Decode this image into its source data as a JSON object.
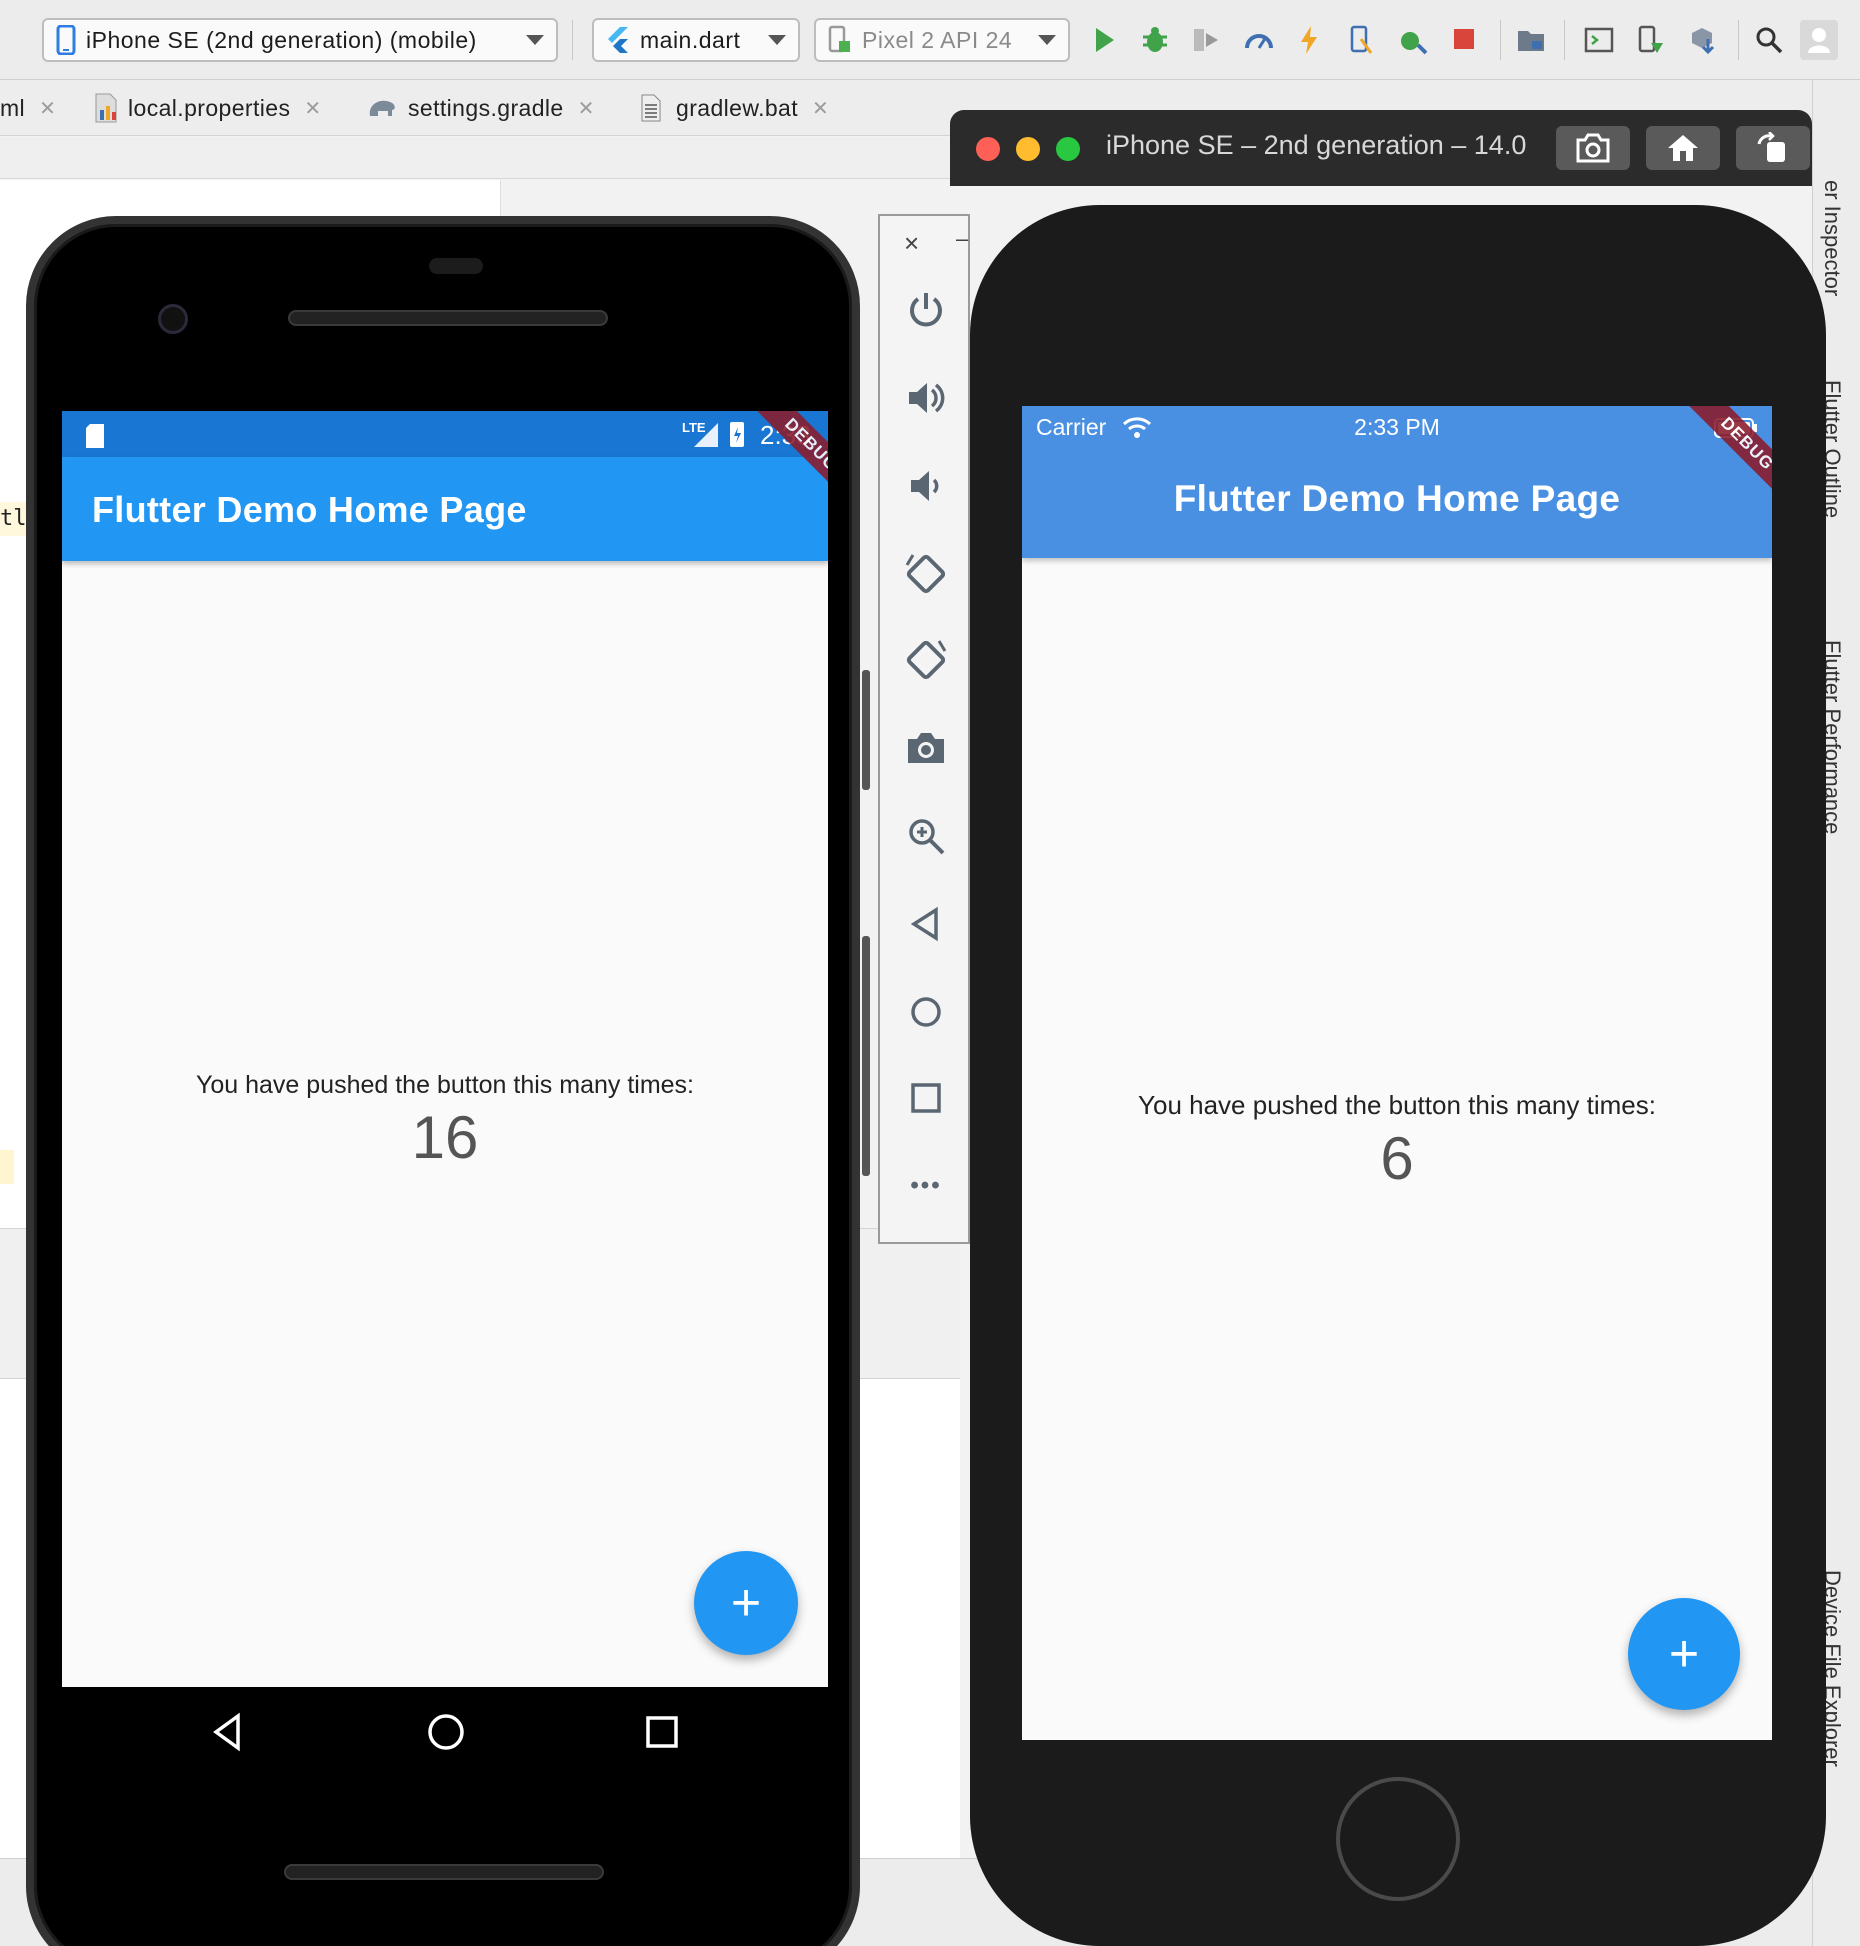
{
  "toolbar": {
    "device_select": "iPhone SE (2nd generation) (mobile)",
    "run_config": "main.dart",
    "emulator_select": "Pixel 2 API 24"
  },
  "tabs": [
    {
      "label": "ml"
    },
    {
      "label": "local.properties"
    },
    {
      "label": "settings.gradle"
    },
    {
      "label": "gradlew.bat"
    }
  ],
  "editor": {
    "fragment": "tl"
  },
  "android": {
    "status_time": "2:33",
    "status_network": "LTE",
    "app_title": "Flutter Demo Home Page",
    "debug_banner": "DEBUG",
    "message": "You have pushed the button this many times:",
    "counter": "16",
    "fab_label": "+"
  },
  "emulator_panel": {
    "close": "×",
    "minimize": "–",
    "more": "•••"
  },
  "ios_simulator": {
    "window_title": "iPhone SE – 2nd generation – 14.0",
    "carrier": "Carrier",
    "time": "2:33 PM",
    "app_title": "Flutter Demo Home Page",
    "debug_banner": "DEBUG",
    "message": "You have pushed the button this many times:",
    "counter": "6",
    "fab_label": "+"
  },
  "side_tools": {
    "inspector": "er Inspector",
    "outline": "Flutter Outline",
    "performance": "Flutter Performance",
    "device_explorer": "Device File Explorer"
  },
  "colors": {
    "android_appbar": "#2196f3",
    "android_statusbar": "#1976d2",
    "ios_appbar": "#4a90e2",
    "fab": "#2196f3",
    "debug_ribbon": "#8a1b2b"
  }
}
